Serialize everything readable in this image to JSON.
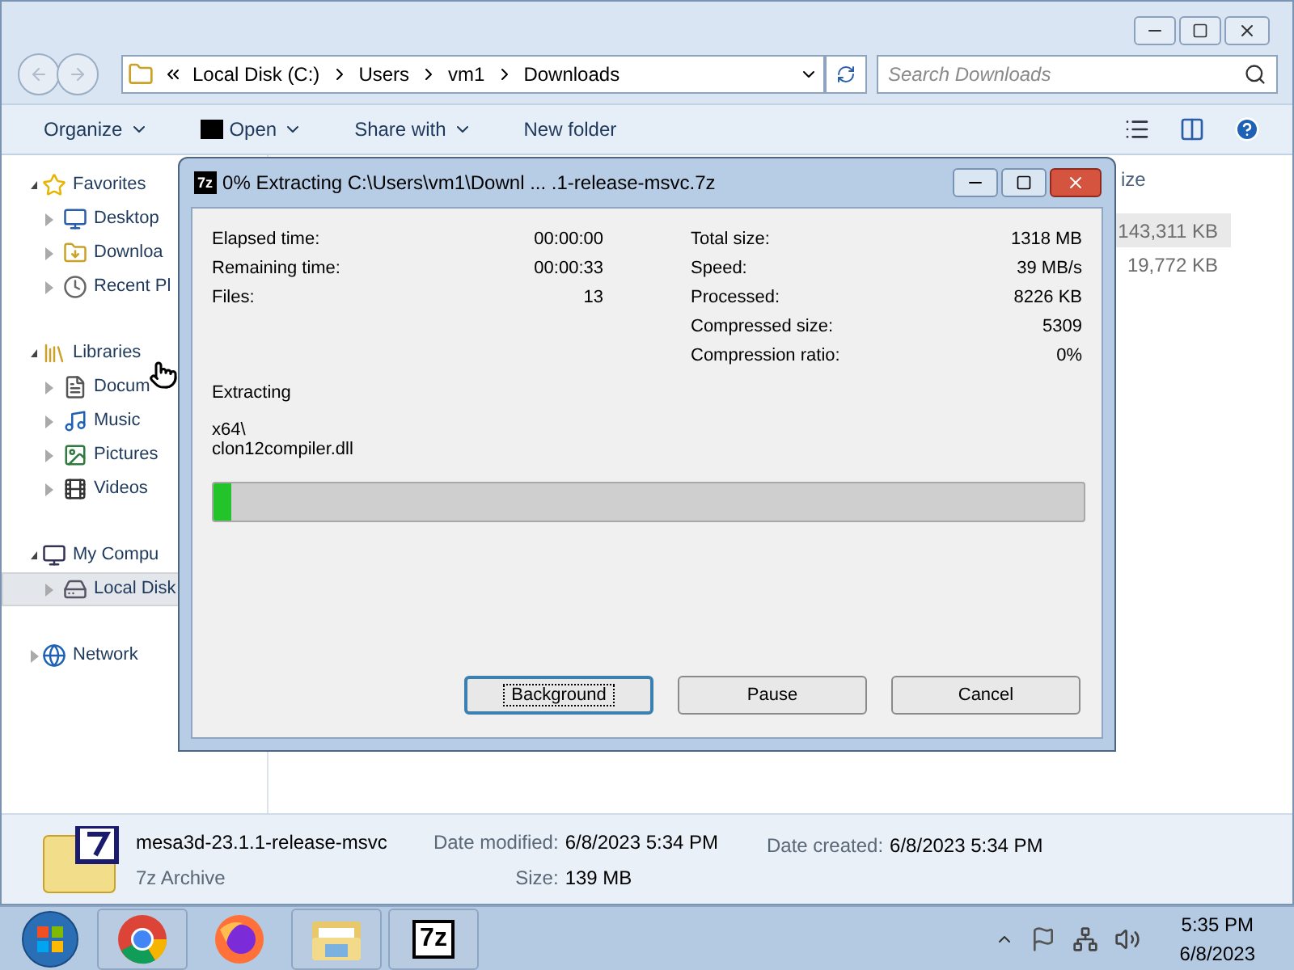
{
  "explorer": {
    "address": {
      "crumbs": [
        "Local Disk (C:)",
        "Users",
        "vm1",
        "Downloads"
      ]
    },
    "search": {
      "placeholder": "Search Downloads"
    },
    "toolbar": [
      {
        "label": "Organize",
        "kind": "menu"
      },
      {
        "label": "Open",
        "kind": "app-menu"
      },
      {
        "label": "Share with",
        "kind": "menu"
      },
      {
        "label": "New folder",
        "kind": "plain"
      }
    ],
    "nav": [
      {
        "label": "Favorites",
        "kind": "star",
        "expanded": true,
        "selected": false,
        "children": [
          {
            "label": "Desktop",
            "kind": "desktop",
            "selected": false
          },
          {
            "label": "Downloa",
            "kind": "downloads",
            "selected": false
          },
          {
            "label": "Recent Pl",
            "kind": "recent",
            "selected": false
          }
        ]
      },
      {
        "label": "Libraries",
        "kind": "library",
        "expanded": true,
        "selected": false,
        "children": [
          {
            "label": "Docum",
            "kind": "document",
            "selected": false
          },
          {
            "label": "Music",
            "kind": "music",
            "selected": false
          },
          {
            "label": "Pictures",
            "kind": "pictures",
            "selected": false
          },
          {
            "label": "Videos",
            "kind": "videos",
            "selected": false
          }
        ]
      },
      {
        "label": "My Compu",
        "kind": "computer",
        "expanded": true,
        "selected": false,
        "children": [
          {
            "label": "Local Disk",
            "kind": "disk",
            "selected": true
          }
        ]
      },
      {
        "label": "Network",
        "kind": "network",
        "expanded": false,
        "selected": false
      }
    ],
    "column_header": "ize",
    "rows": [
      {
        "size": "143,311 KB",
        "selected": true
      },
      {
        "size": "19,772 KB",
        "selected": false
      }
    ],
    "details": {
      "name": "mesa3d-23.1.1-release-msvc",
      "type": "7z Archive",
      "fields": [
        {
          "label": "Date modified:",
          "value": "6/8/2023 5:34 PM"
        },
        {
          "label": "Size:",
          "value": "139 MB"
        },
        {
          "label": "Date created:",
          "value": "6/8/2023 5:34 PM"
        }
      ]
    }
  },
  "dialog": {
    "icon_label": "7z",
    "title": "0% Extracting C:\\Users\\vm1\\Downl ... .1-release-msvc.7z",
    "left_stats": [
      {
        "label": "Elapsed time:",
        "value": "00:00:00"
      },
      {
        "label": "Remaining time:",
        "value": "00:00:33"
      },
      {
        "label": "Files:",
        "value": "13"
      }
    ],
    "right_stats": [
      {
        "label": "Total size:",
        "value": "1318 MB"
      },
      {
        "label": "Speed:",
        "value": "39 MB/s"
      },
      {
        "label": "Processed:",
        "value": "8226 KB"
      },
      {
        "label": "Compressed size:",
        "value": "5309"
      },
      {
        "label": "Compression ratio:",
        "value": "0%"
      }
    ],
    "status": "Extracting",
    "path_lines": [
      "x64\\",
      "clon12compiler.dll"
    ],
    "progress": {
      "level": 0.02
    },
    "buttons": [
      {
        "label": "Background",
        "selected": true
      },
      {
        "label": "Pause",
        "selected": false
      },
      {
        "label": "Cancel",
        "selected": false
      }
    ]
  },
  "taskbar": {
    "apps": [
      {
        "kind": "chrome",
        "active": true
      },
      {
        "kind": "firefox",
        "active": false
      },
      {
        "kind": "explorer",
        "active": true
      },
      {
        "kind": "sevenzip",
        "label": "7z",
        "active": true
      }
    ],
    "clock": {
      "time": "5:35 PM",
      "date": "6/8/2023"
    }
  }
}
